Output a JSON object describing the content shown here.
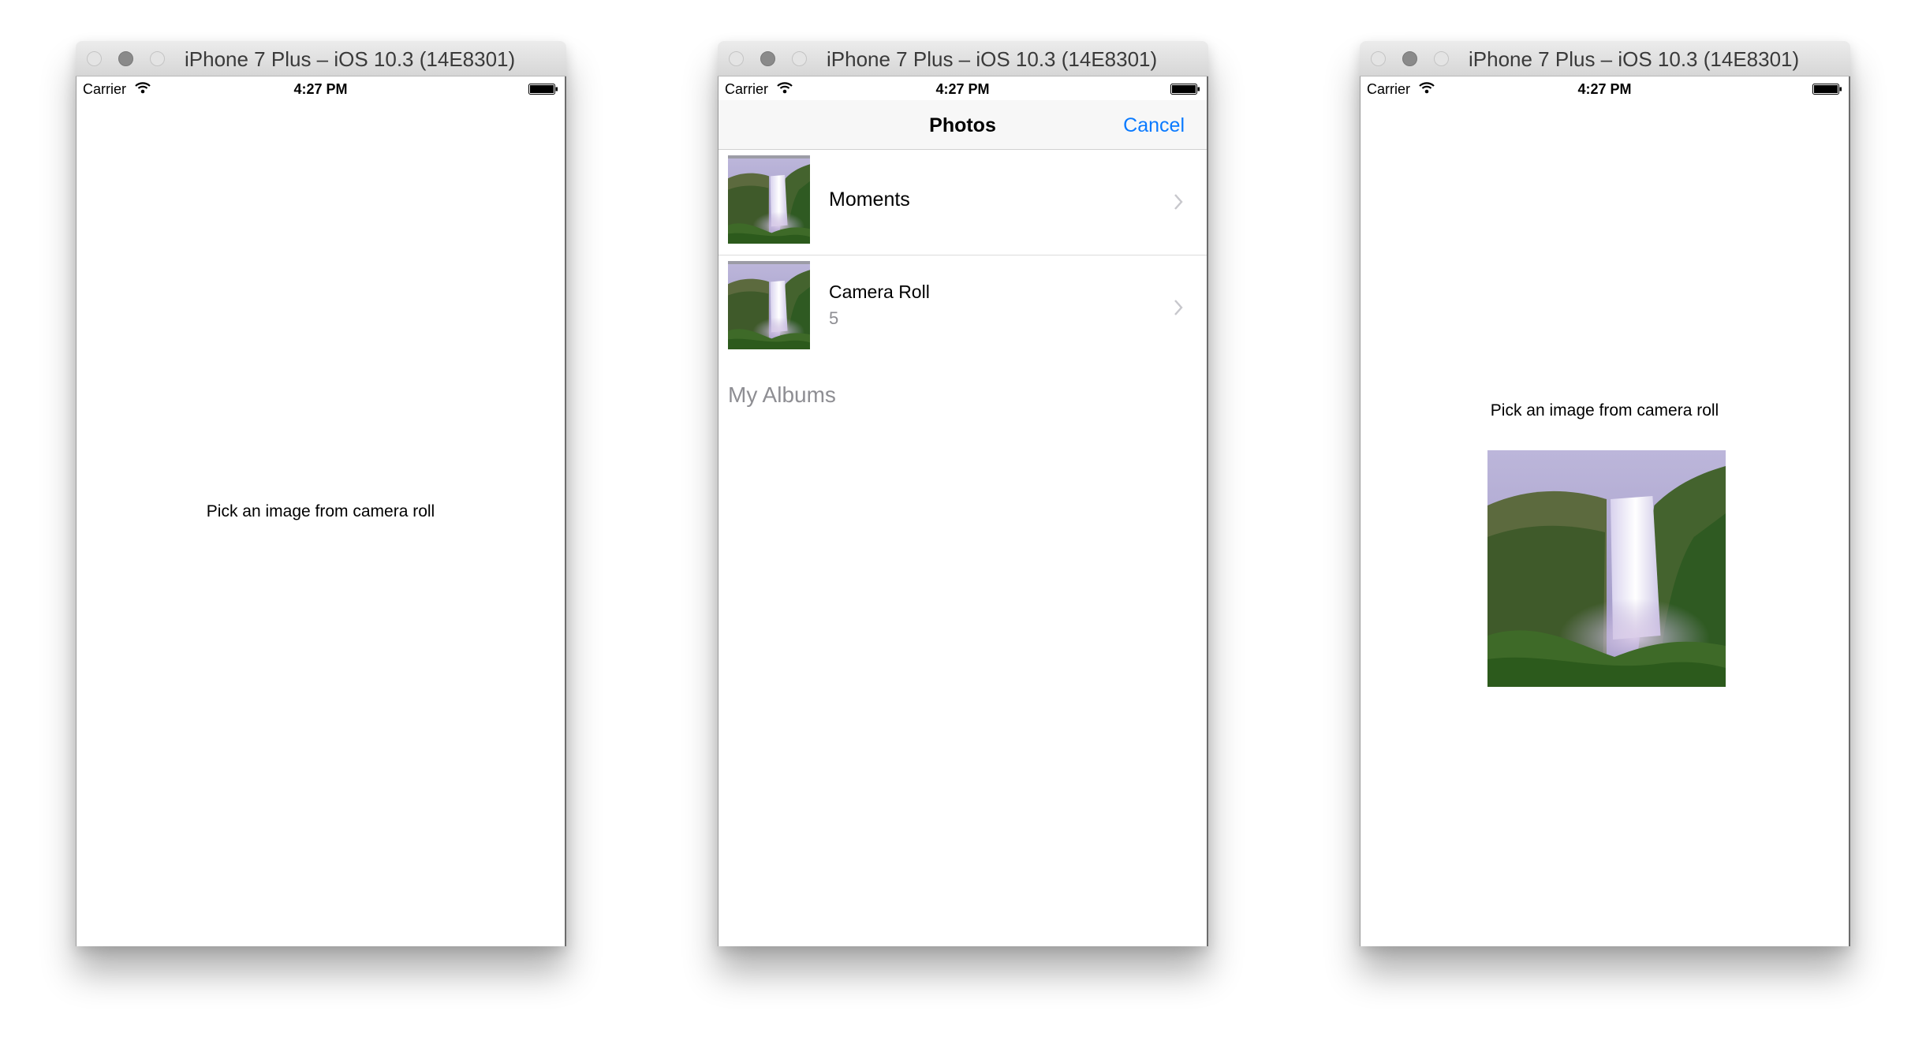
{
  "windows": [
    {
      "title": "iPhone 7 Plus – iOS 10.3 (14E8301)",
      "status": {
        "carrier": "Carrier",
        "time": "4:27 PM"
      },
      "label": "Pick an image from camera roll"
    },
    {
      "title": "iPhone 7 Plus – iOS 10.3 (14E8301)",
      "status": {
        "carrier": "Carrier",
        "time": "4:27 PM"
      },
      "nav": {
        "title": "Photos",
        "cancel": "Cancel"
      },
      "albums": [
        {
          "name": "Moments"
        },
        {
          "name": "Camera Roll",
          "count": "5"
        }
      ],
      "section_header": "My Albums"
    },
    {
      "title": "iPhone 7 Plus – iOS 10.3 (14E8301)",
      "status": {
        "carrier": "Carrier",
        "time": "4:27 PM"
      },
      "label": "Pick an image from camera roll"
    }
  ],
  "colors": {
    "accent": "#0a7aff",
    "secondary_text": "#8e8e93"
  }
}
